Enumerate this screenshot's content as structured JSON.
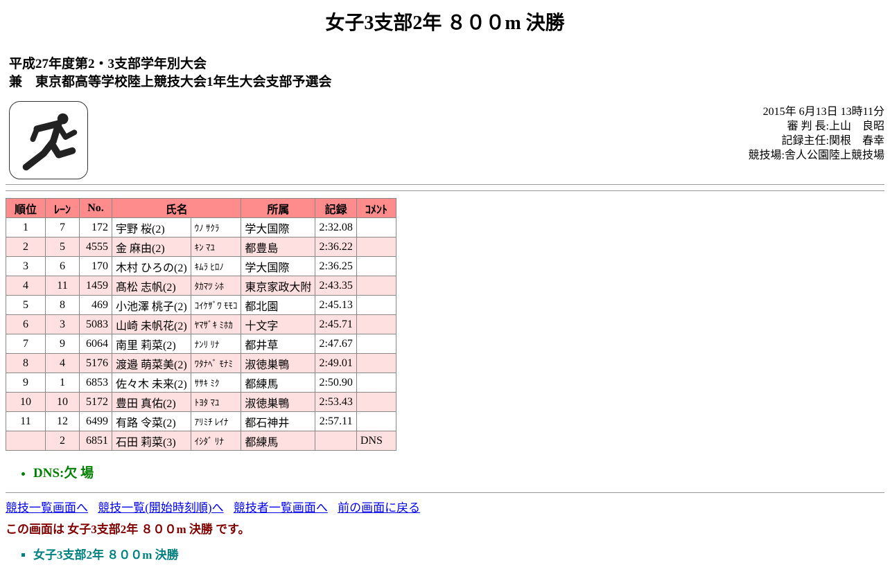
{
  "title": "女子3支部2年 ８００m 決勝",
  "meet": {
    "line1": "平成27年度第2・3支部学年別大会",
    "line2": "兼　東京都高等学校陸上競技大会1年生大会支部予選会"
  },
  "logo_icon": "runner-pictogram",
  "info": {
    "datetime": "2015年 6月13日 13時11分",
    "judge": "審 判 長:上山　良昭",
    "recorder": "記録主任:関根　春幸",
    "venue": "競技場:舎人公園陸上競技場"
  },
  "columns": [
    "順位",
    "ﾚｰﾝ",
    "No.",
    "氏名",
    "所属",
    "記録",
    "ｺﾒﾝﾄ"
  ],
  "rows": [
    {
      "rank": "1",
      "lane": "7",
      "no": "172",
      "name": "宇野 桜(2)",
      "kana": "ｳﾉ ｻｸﾗ",
      "team": "学大国際",
      "record": "2:32.08",
      "comment": ""
    },
    {
      "rank": "2",
      "lane": "5",
      "no": "4555",
      "name": "金 麻由(2)",
      "kana": "ｷﾝ ﾏﾕ",
      "team": "都豊島",
      "record": "2:36.22",
      "comment": ""
    },
    {
      "rank": "3",
      "lane": "6",
      "no": "170",
      "name": "木村 ひろの(2)",
      "kana": "ｷﾑﾗ ﾋﾛﾉ",
      "team": "学大国際",
      "record": "2:36.25",
      "comment": ""
    },
    {
      "rank": "4",
      "lane": "11",
      "no": "1459",
      "name": "髙松 志帆(2)",
      "kana": "ﾀｶﾏﾂ ｼﾎ",
      "team": "東京家政大附",
      "record": "2:43.35",
      "comment": ""
    },
    {
      "rank": "5",
      "lane": "8",
      "no": "469",
      "name": "小池澤 桃子(2)",
      "kana": "ｺｲｹｻﾞﾜ ﾓﾓｺ",
      "team": "都北園",
      "record": "2:45.13",
      "comment": ""
    },
    {
      "rank": "6",
      "lane": "3",
      "no": "5083",
      "name": "山崎 未帆花(2)",
      "kana": "ﾔﾏｻﾞｷ ﾐﾎｶ",
      "team": "十文字",
      "record": "2:45.71",
      "comment": ""
    },
    {
      "rank": "7",
      "lane": "9",
      "no": "6064",
      "name": "南里 莉菜(2)",
      "kana": "ﾅﾝﾘ ﾘﾅ",
      "team": "都井草",
      "record": "2:47.67",
      "comment": ""
    },
    {
      "rank": "8",
      "lane": "4",
      "no": "5176",
      "name": "渡邉 萌菜美(2)",
      "kana": "ﾜﾀﾅﾍﾞ ﾓﾅﾐ",
      "team": "淑徳巣鴨",
      "record": "2:49.01",
      "comment": ""
    },
    {
      "rank": "9",
      "lane": "1",
      "no": "6853",
      "name": "佐々木 未来(2)",
      "kana": "ｻｻｷ ﾐｸ",
      "team": "都練馬",
      "record": "2:50.90",
      "comment": ""
    },
    {
      "rank": "10",
      "lane": "10",
      "no": "5172",
      "name": "豊田 真佑(2)",
      "kana": "ﾄﾖﾀ ﾏﾕ",
      "team": "淑徳巣鴨",
      "record": "2:53.43",
      "comment": ""
    },
    {
      "rank": "11",
      "lane": "12",
      "no": "6499",
      "name": "有路 令菜(2)",
      "kana": "ｱﾘﾐﾁ ﾚｲﾅ",
      "team": "都石神井",
      "record": "2:57.11",
      "comment": ""
    },
    {
      "rank": "",
      "lane": "2",
      "no": "6851",
      "name": "石田 莉菜(3)",
      "kana": "ｲｼﾀﾞ ﾘﾅ",
      "team": "都練馬",
      "record": "",
      "comment": "DNS"
    }
  ],
  "legend": [
    "DNS:欠 場"
  ],
  "nav": {
    "links": [
      "競技一覧画面へ",
      "競技一覧(開始時刻順)へ",
      "競技者一覧画面へ",
      "前の画面に戻る"
    ]
  },
  "note": "この画面は 女子3支部2年 ８００m 決勝 です。",
  "sub": [
    "女子3支部2年 ８００m 決勝"
  ]
}
